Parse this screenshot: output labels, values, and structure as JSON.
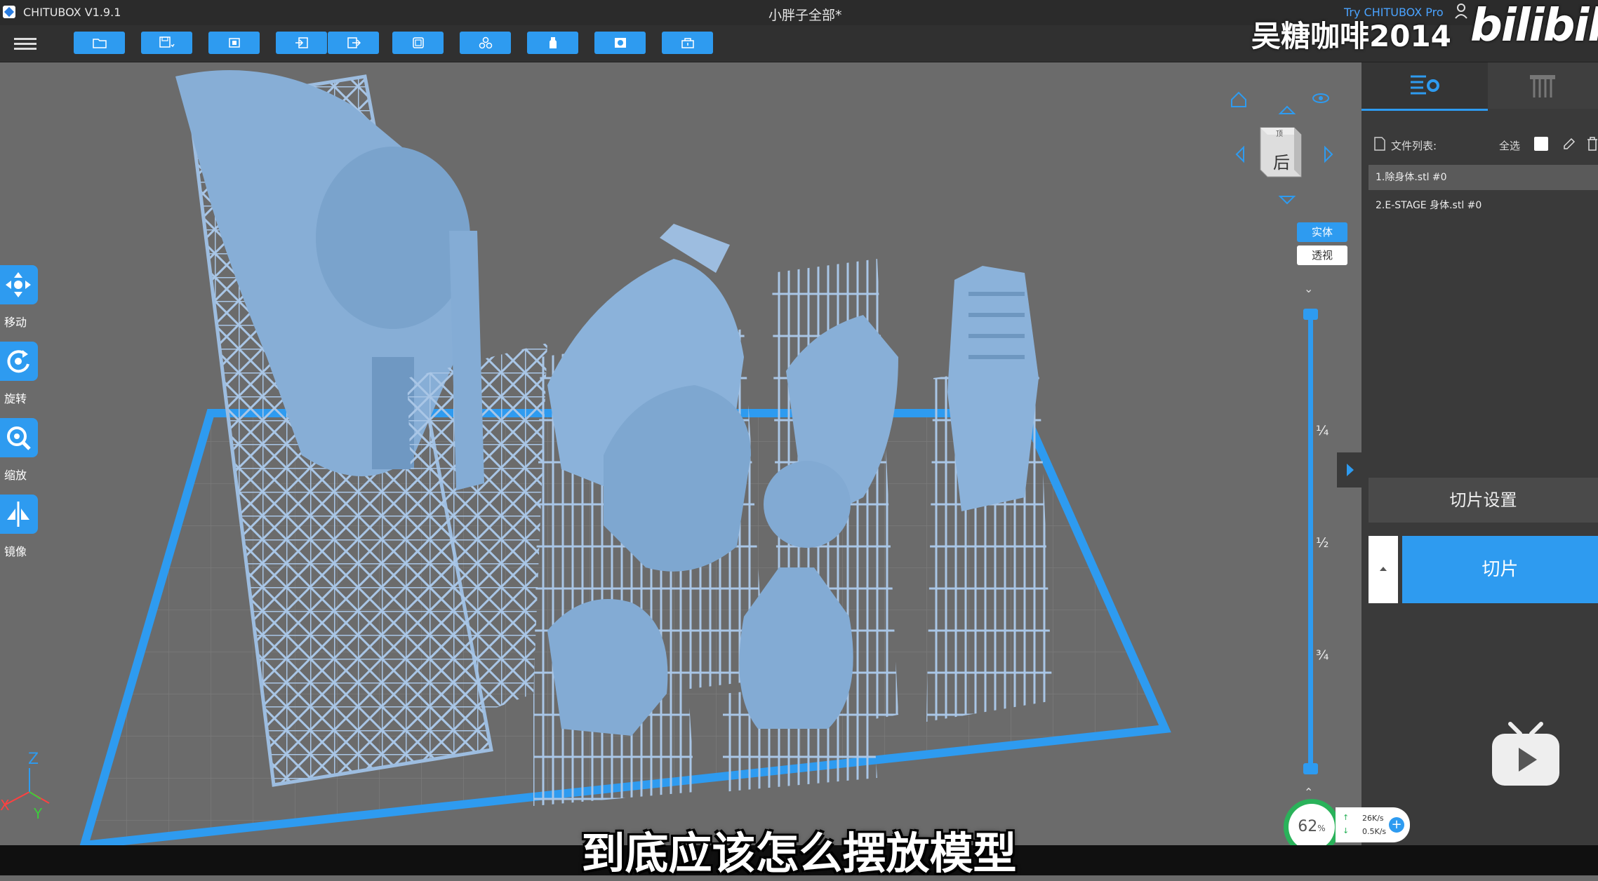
{
  "app": {
    "name": "CHITUBOX V1.9.1",
    "document_title": "小胖子全部*",
    "try_pro": "Try CHITUBOX Pro"
  },
  "toolbar": {
    "buttons": [
      {
        "icon": "open-folder-icon"
      },
      {
        "icon": "save-icon"
      },
      {
        "icon": "center-icon"
      },
      {
        "icon": "import-icon"
      },
      {
        "icon": "export-icon"
      },
      {
        "icon": "layout-icon"
      },
      {
        "icon": "arrange-icon"
      },
      {
        "icon": "support-icon"
      },
      {
        "icon": "hollow-icon"
      },
      {
        "icon": "tray-icon"
      }
    ]
  },
  "left_tools": [
    {
      "label": "移动",
      "icon": "move-icon"
    },
    {
      "label": "旋转",
      "icon": "rotate-icon"
    },
    {
      "label": "缩放",
      "icon": "scale-icon"
    },
    {
      "label": "镜像",
      "icon": "mirror-icon"
    }
  ],
  "view_cube": {
    "face": "后",
    "top_face": "顶"
  },
  "view_modes": {
    "solid": "实体",
    "transparent": "透视"
  },
  "layer_slider": {
    "ticks": [
      "¼",
      "½",
      "¾"
    ]
  },
  "right_panel": {
    "file_list_label": "文件列表:",
    "select_all_label": "全选",
    "files": [
      "1.除身体.stl #0",
      "2.E-STAGE 身体.stl #0"
    ],
    "selected_index": 0,
    "slice_settings_label": "切片设置",
    "slice_label": "切片"
  },
  "status": {
    "percent": "62",
    "percent_unit": "%",
    "upload_speed": "26K/s",
    "download_speed": "0.5K/s"
  },
  "overlay": {
    "watermark": "吴糖咖啡2014",
    "brand": "bilibili",
    "subtitle": "到底应该怎么摆放模型"
  },
  "colors": {
    "accent": "#2e9bf0",
    "model": "#8cb4dc",
    "plate": "#5a5a5a",
    "plate_border": "#2e9bf0"
  }
}
